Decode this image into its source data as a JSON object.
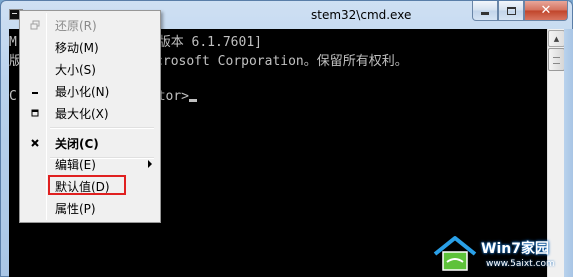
{
  "window": {
    "title": "C:\\Windows\\system32\\cmd.exe",
    "title_visible": "stem32\\cmd.exe",
    "icon": "cmd-icon",
    "buttons": {
      "minimize": "minimize-icon",
      "maximize": "maximize-icon",
      "close": "✕"
    }
  },
  "console": {
    "lines": [
      "M                  版本 6.1.7601]",
      "版                icrosoft Corporation。保留所有权利。",
      "",
      "C                  tor>"
    ],
    "text_color": "#c0c0c0",
    "background": "#000000"
  },
  "menu": {
    "items": [
      {
        "label": "还原(R)",
        "icon": "restore-icon",
        "disabled": true
      },
      {
        "label": "移动(M)",
        "icon": "",
        "disabled": false
      },
      {
        "label": "大小(S)",
        "icon": "",
        "disabled": false
      },
      {
        "label": "最小化(N)",
        "icon": "minimize-icon",
        "disabled": false
      },
      {
        "label": "最大化(X)",
        "icon": "maximize-icon",
        "disabled": false
      },
      {
        "label": "关闭(C)",
        "icon": "close-icon",
        "bold": true
      },
      {
        "label": "编辑(E)",
        "icon": "",
        "submenu": true
      },
      {
        "label": "默认值(D)",
        "icon": "",
        "highlighted": true
      },
      {
        "label": "属性(P)",
        "icon": ""
      }
    ],
    "highlight_color": "#e02020"
  },
  "watermark": {
    "title": "Win7家园",
    "url": "www.5aixt.com"
  }
}
